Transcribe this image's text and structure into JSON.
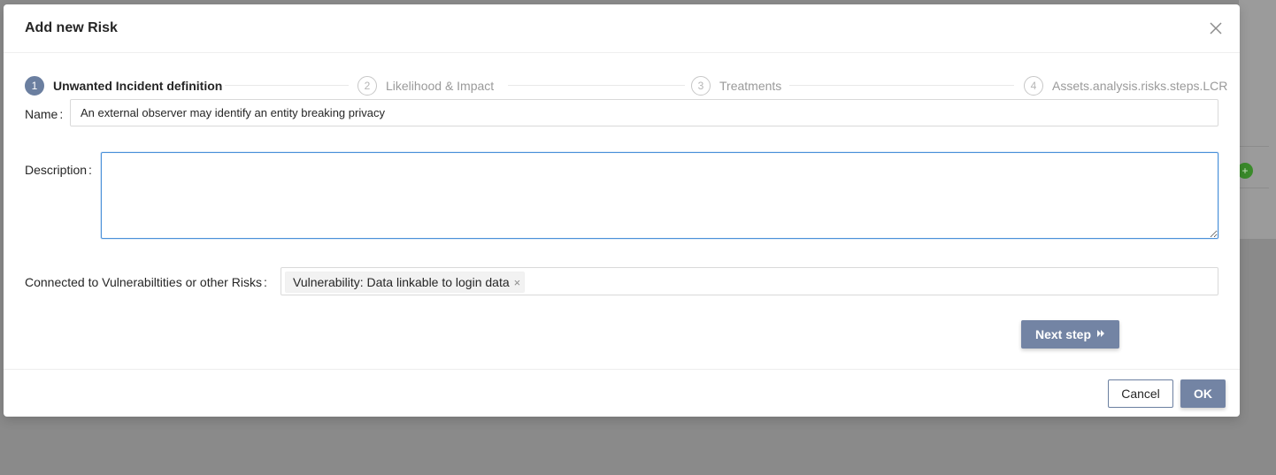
{
  "modal": {
    "title": "Add new Risk",
    "close_icon": "close-icon"
  },
  "steps": [
    {
      "number": "1",
      "title": "Unwanted Incident definition",
      "active": true
    },
    {
      "number": "2",
      "title": "Likelihood & Impact",
      "active": false
    },
    {
      "number": "3",
      "title": "Treatments",
      "active": false
    },
    {
      "number": "4",
      "title": "Assets.analysis.risks.steps.LCR",
      "active": false
    }
  ],
  "form": {
    "name_label": "Name",
    "name_value": "An external observer may identify an entity breaking privacy",
    "description_label": "Description",
    "description_value": "",
    "connected_label": "Connected to Vulnerabiltities or other Risks",
    "connected_tags": [
      "Vulnerability: Data linkable to login data"
    ],
    "tag_remove_glyph": "×"
  },
  "buttons": {
    "next_step": "Next step",
    "next_icon": "double-chevron-right-icon",
    "cancel": "Cancel",
    "ok": "OK"
  },
  "colors": {
    "primary": "#7384a4",
    "focus_border": "#4a90d9",
    "overlay": "#8a8a8a"
  }
}
